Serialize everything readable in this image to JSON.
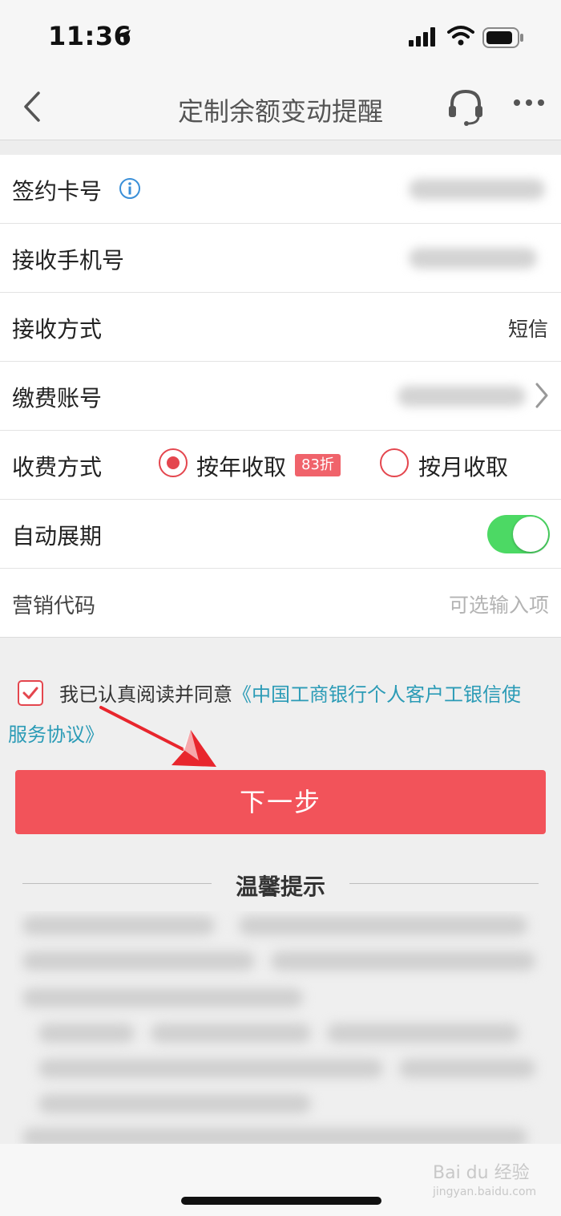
{
  "status_bar": {
    "time": "11:36"
  },
  "nav": {
    "title": "定制余额变动提醒"
  },
  "form": {
    "card_label": "签约卡号",
    "phone_label": "接收手机号",
    "method_label": "接收方式",
    "method_value": "短信",
    "account_label": "缴费账号",
    "fee_label": "收费方式",
    "fee_yearly": "按年收取",
    "fee_discount": "83折",
    "fee_monthly": "按月收取",
    "auto_renew_label": "自动展期",
    "auto_renew_on": true,
    "promo_label": "营销代码",
    "promo_placeholder": "可选输入项"
  },
  "agreement": {
    "prefix": "我已认真阅读并同意",
    "link_part1": "《中国工商银行个人客户工银信使",
    "link_part2": "服务协议》",
    "checked": true
  },
  "next_button": "下一步",
  "tips": {
    "title": "温馨提示"
  },
  "watermark": {
    "main": "Bai du 经验",
    "sub": "jingyan.baidu.com"
  },
  "colors": {
    "accent": "#f2535a",
    "link": "#2b9bb6",
    "toggle_on": "#4cd964"
  }
}
